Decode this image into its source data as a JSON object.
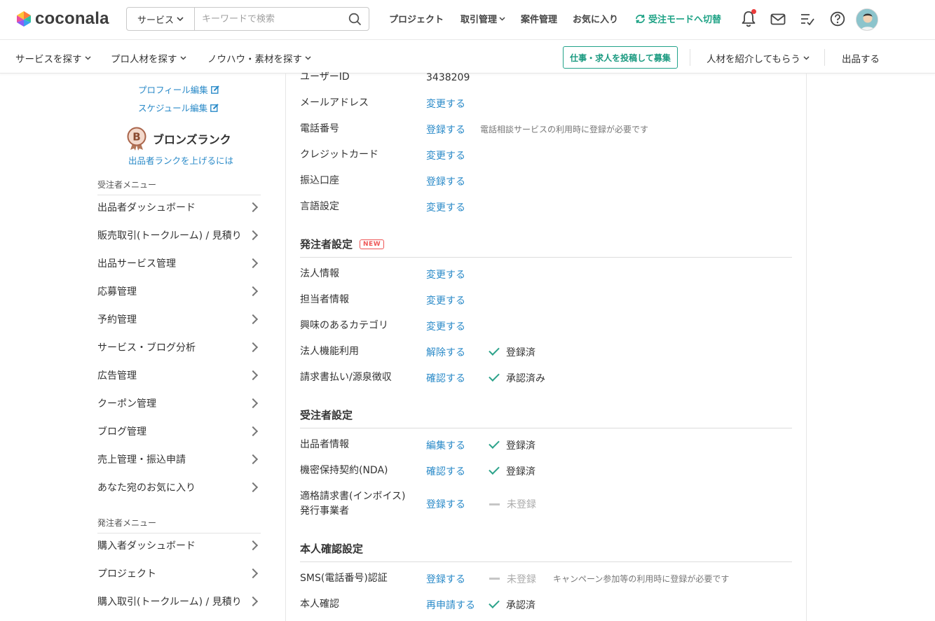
{
  "header": {
    "logo_text": "coconala",
    "search": {
      "category_label": "サービス",
      "placeholder": "キーワードで検索"
    },
    "nav": {
      "projects": "プロジェクト",
      "transactions": "取引管理",
      "jobs": "案件管理",
      "favorites": "お気に入り",
      "switch_mode": "受注モードへ切替"
    }
  },
  "subheader": {
    "find_services": "サービスを探す",
    "find_pros": "プロ人材を探す",
    "find_knowhow": "ノウハウ・素材を探す",
    "post_job_button": "仕事・求人を投稿して募集",
    "referral": "人材を紹介してもらう",
    "sell": "出品する"
  },
  "sidebar": {
    "profile_edit": "プロフィール編集",
    "schedule_edit": "スケジュール編集",
    "rank_label": "ブロンズランク",
    "rank_letter": "B",
    "rank_help": "出品者ランクを上げるには",
    "seller_menu_title": "受注者メニュー",
    "seller_menu": [
      "出品者ダッシュボード",
      "販売取引(トークルーム) / 見積り",
      "出品サービス管理",
      "応募管理",
      "予約管理",
      "サービス・ブログ分析",
      "広告管理",
      "クーポン管理",
      "ブログ管理",
      "売上管理・振込申請",
      "あなた宛のお気に入り"
    ],
    "buyer_menu_title": "発注者メニュー",
    "buyer_menu": [
      "購入者ダッシュボード",
      "プロジェクト",
      "購入取引(トークルーム) / 見積り"
    ]
  },
  "account": {
    "user_id": {
      "label": "ユーザーID",
      "value": "3438209"
    },
    "email": {
      "label": "メールアドレス",
      "action": "変更する"
    },
    "phone": {
      "label": "電話番号",
      "action": "登録する",
      "note": "電話相談サービスの利用時に登録が必要です"
    },
    "credit_card": {
      "label": "クレジットカード",
      "action": "変更する"
    },
    "bank": {
      "label": "振込口座",
      "action": "登録する"
    },
    "language": {
      "label": "言語設定",
      "action": "変更する"
    }
  },
  "buyer_settings": {
    "title": "発注者設定",
    "badge": "NEW",
    "rows": [
      {
        "label": "法人情報",
        "action": "変更する"
      },
      {
        "label": "担当者情報",
        "action": "変更する"
      },
      {
        "label": "興味のあるカテゴリ",
        "action": "変更する"
      },
      {
        "label": "法人機能利用",
        "action": "解除する",
        "status": "登録済"
      },
      {
        "label": "請求書払い/源泉徴収",
        "action": "確認する",
        "status": "承認済み"
      }
    ]
  },
  "seller_settings": {
    "title": "受注者設定",
    "rows": [
      {
        "label": "出品者情報",
        "action": "編集する",
        "status": "登録済"
      },
      {
        "label": "機密保持契約(NDA)",
        "action": "確認する",
        "status": "登録済"
      },
      {
        "label_line1": "適格請求書(インボイス)",
        "label_line2": "発行事業者",
        "action": "登録する",
        "status": "未登録"
      }
    ]
  },
  "identity_settings": {
    "title": "本人確認設定",
    "rows": [
      {
        "label": "SMS(電話番号)認証",
        "action": "登録する",
        "status": "未登録",
        "note": "キャンペーン参加等の利用時に登録が必要です"
      },
      {
        "label": "本人確認",
        "action": "再申請する",
        "status": "承認済"
      }
    ]
  },
  "colors": {
    "accent": "#1fa386",
    "link": "#2a8ac8",
    "notification": "#ea3b3b"
  }
}
